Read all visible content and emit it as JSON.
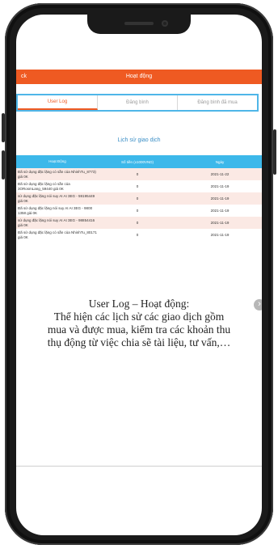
{
  "app": {
    "back_label": "ck",
    "title": "Hoạt động",
    "tabs": [
      {
        "label": "User Log",
        "active": true
      },
      {
        "label": "Đăng bình",
        "active": false
      },
      {
        "label": "Đăng bình đã mua",
        "active": false
      }
    ],
    "subtitle": "Lịch sử giao dịch",
    "table": {
      "headers": [
        "Hoạt Động",
        "Số tiền (x1000VND)",
        "Ngày"
      ],
      "rows": [
        {
          "activity": "Đã sử dụng đặc lặng có sẵn của NhinhTu_8773) giá 0K",
          "amount": "0",
          "date": "2021-11-22"
        },
        {
          "activity": "Đã sử dụng đặc lặng có sẵn của 3ORosmLang_59440 giá 0K",
          "amount": "0",
          "date": "2021-11-19"
        },
        {
          "activity": "sử dụng đặc lặng nói suy AI AI 3EG - 59195449 giá 0K",
          "amount": "0",
          "date": "2021-11-19"
        },
        {
          "activity": "Đã sử dụng đặc lặng nói suy AI AI 3EG - 9800 1358 giá 0K",
          "amount": "0",
          "date": "2021-11-19"
        },
        {
          "activity": "sử dụng đặc lặng nói suy AI AI 3EG - 98854416 giá 0K",
          "amount": "0",
          "date": "2021-11-19"
        },
        {
          "activity": "Đã sử dụng đặc lặng có sẵn của NhinhTu_80171 giá 0K",
          "amount": "0",
          "date": "2021-11-19"
        }
      ]
    }
  },
  "caption": {
    "heading": "User Log – Hoạt động:",
    "line1": "Thể hiện các lịch sử các giao dịch gồm",
    "line2": "mua và được mua, kiểm tra các khoản thu",
    "line3": "thụ động từ việc chia sẽ tài liệu, tư vấn,…"
  },
  "icons": {
    "scroll": "chevron-right-icon",
    "notch_camera": "camera-icon"
  },
  "colors": {
    "header_bar": "#ef5a22",
    "tab_border": "#4fb6e8",
    "table_header": "#3cb8ea",
    "row_alt": "#fbe9e4"
  }
}
